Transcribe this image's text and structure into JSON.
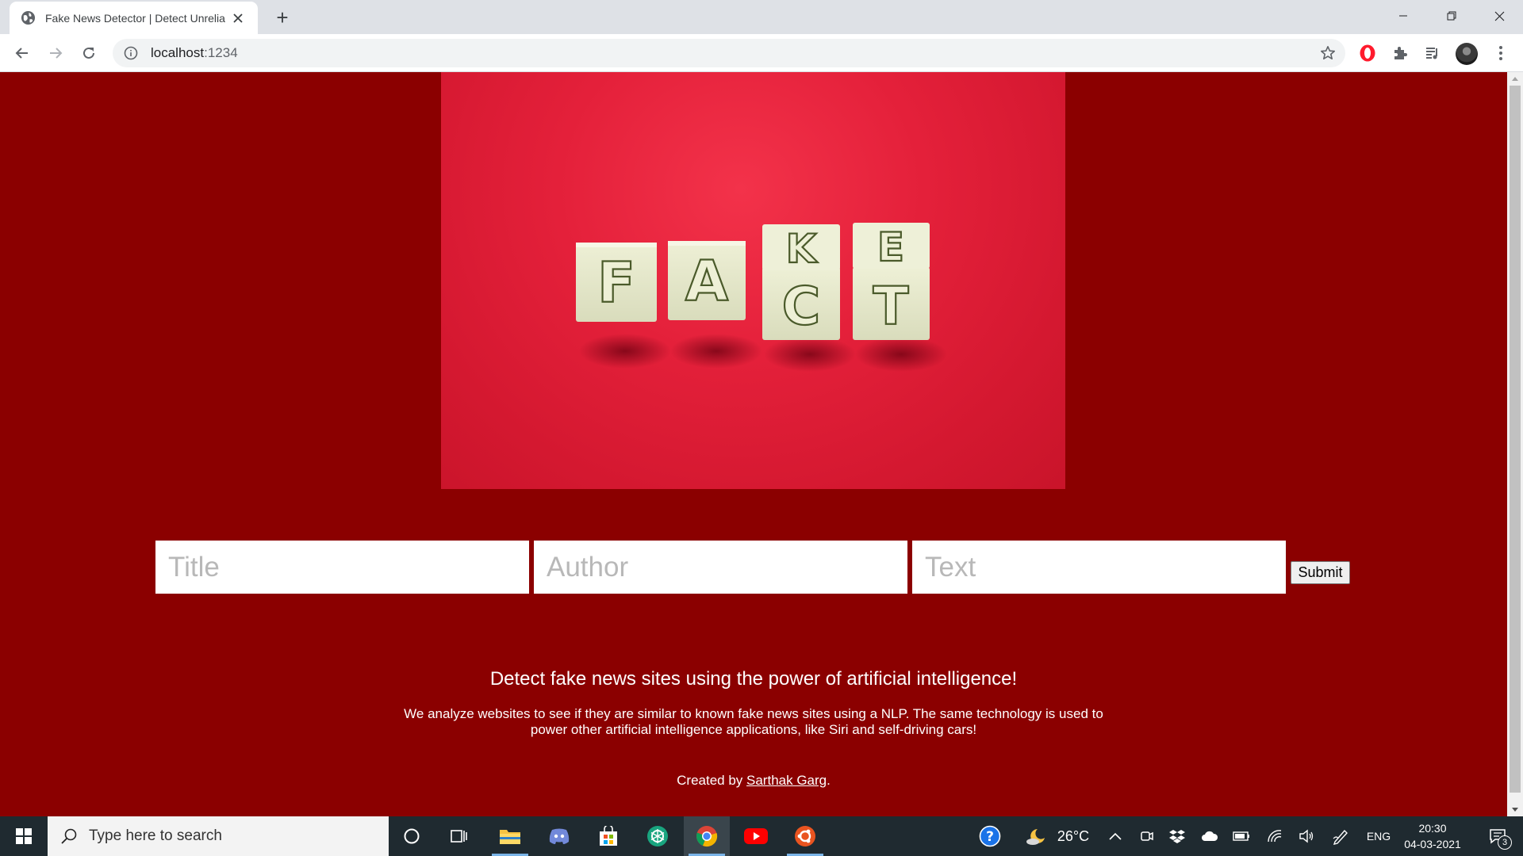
{
  "browser": {
    "tab_title": "Fake News Detector | Detect Unrelia",
    "new_tab_symbol": "+",
    "url_host": "localhost",
    "url_port": ":1234"
  },
  "hero": {
    "top_letters": [
      "K",
      "E"
    ],
    "bottom_letters": [
      "F",
      "A",
      "C",
      "T"
    ]
  },
  "form": {
    "title_placeholder": "Title",
    "author_placeholder": "Author",
    "text_placeholder": "Text",
    "submit_label": "Submit"
  },
  "content": {
    "headline": "Detect fake news sites using the power of artificial intelligence!",
    "description": "We analyze websites to see if they are similar to known fake news sites using a NLP. The same technology is used to power other artificial intelligence applications, like Siri and self-driving cars!",
    "credit_prefix": "Created by ",
    "credit_name": "Sarthak Garg",
    "credit_suffix": "."
  },
  "taskbar": {
    "search_placeholder": "Type here to search",
    "temperature": "26°C",
    "language": "ENG",
    "time": "20:30",
    "date": "04-03-2021",
    "notification_count": "3"
  },
  "colors": {
    "page_background": "#8b0000",
    "hero_red": "#e4203a",
    "taskbar": "#1f2a30"
  },
  "icons": [
    "globe-icon",
    "close-icon",
    "back-arrow-icon",
    "forward-arrow-icon",
    "reload-icon",
    "info-icon",
    "star-icon",
    "opera-icon",
    "puzzle-icon",
    "media-queue-icon",
    "kebab-menu-icon",
    "windows-start-icon",
    "search-icon",
    "cortana-icon",
    "task-view-icon",
    "file-explorer-icon",
    "discord-icon",
    "store-icon",
    "chatgpt-icon",
    "chrome-icon",
    "youtube-icon",
    "ubuntu-icon",
    "help-icon",
    "weather-icon",
    "chevron-up-icon",
    "meet-icon",
    "dropbox-icon",
    "onedrive-icon",
    "battery-icon",
    "wifi-icon",
    "volume-icon",
    "pen-icon",
    "notification-icon"
  ]
}
